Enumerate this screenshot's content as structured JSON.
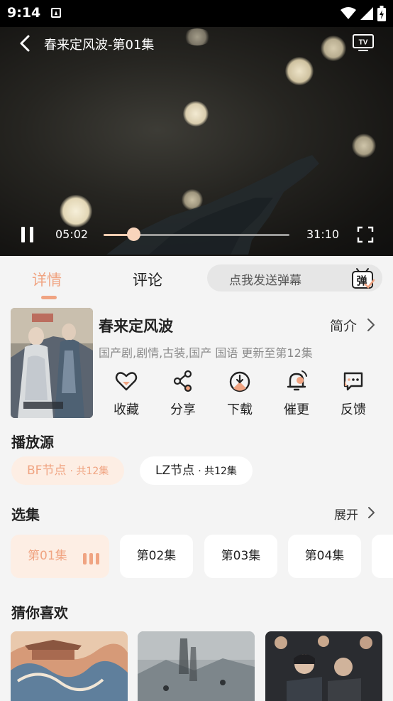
{
  "status_bar": {
    "time": "9:14",
    "icons": [
      "app-notification-icon",
      "wifi-icon",
      "signal-icon",
      "battery-charging-icon"
    ]
  },
  "player": {
    "title": "春来定风波-第01集",
    "current_time": "05:02",
    "total_time": "31:10",
    "progress": 0.16,
    "state": "playing",
    "icons": [
      "back-icon",
      "tv-cast-icon",
      "pause-icon",
      "fullscreen-icon"
    ]
  },
  "tabs": [
    {
      "label": "详情",
      "active": true
    },
    {
      "label": "评论",
      "active": false
    }
  ],
  "danmaku": {
    "placeholder": "点我发送弹幕",
    "icon_label": "弹"
  },
  "show": {
    "title": "春来定风波",
    "intro_label": "简介",
    "meta": "国产剧,剧情,古装,国产 国语 更新至第12集"
  },
  "actions": [
    {
      "label": "收藏",
      "icon": "heart-icon"
    },
    {
      "label": "分享",
      "icon": "share-icon"
    },
    {
      "label": "下载",
      "icon": "download-icon"
    },
    {
      "label": "催更",
      "icon": "bell-icon"
    },
    {
      "label": "反馈",
      "icon": "feedback-icon"
    }
  ],
  "sources": {
    "title": "播放源",
    "items": [
      {
        "name": "BF节点",
        "count": "· 共12集",
        "active": true
      },
      {
        "name": "LZ节点",
        "count": "· 共12集",
        "active": false
      }
    ]
  },
  "episodes": {
    "title": "选集",
    "expand_label": "展开",
    "items": [
      {
        "label": "第01集",
        "active": true
      },
      {
        "label": "第02集",
        "active": false
      },
      {
        "label": "第03集",
        "active": false
      },
      {
        "label": "第04集",
        "active": false
      }
    ]
  },
  "recommend": {
    "title": "猜你喜欢"
  },
  "colors": {
    "accent": "#f0a482",
    "accent_bg": "#fdeee4",
    "page_bg": "#f4f4f4"
  }
}
